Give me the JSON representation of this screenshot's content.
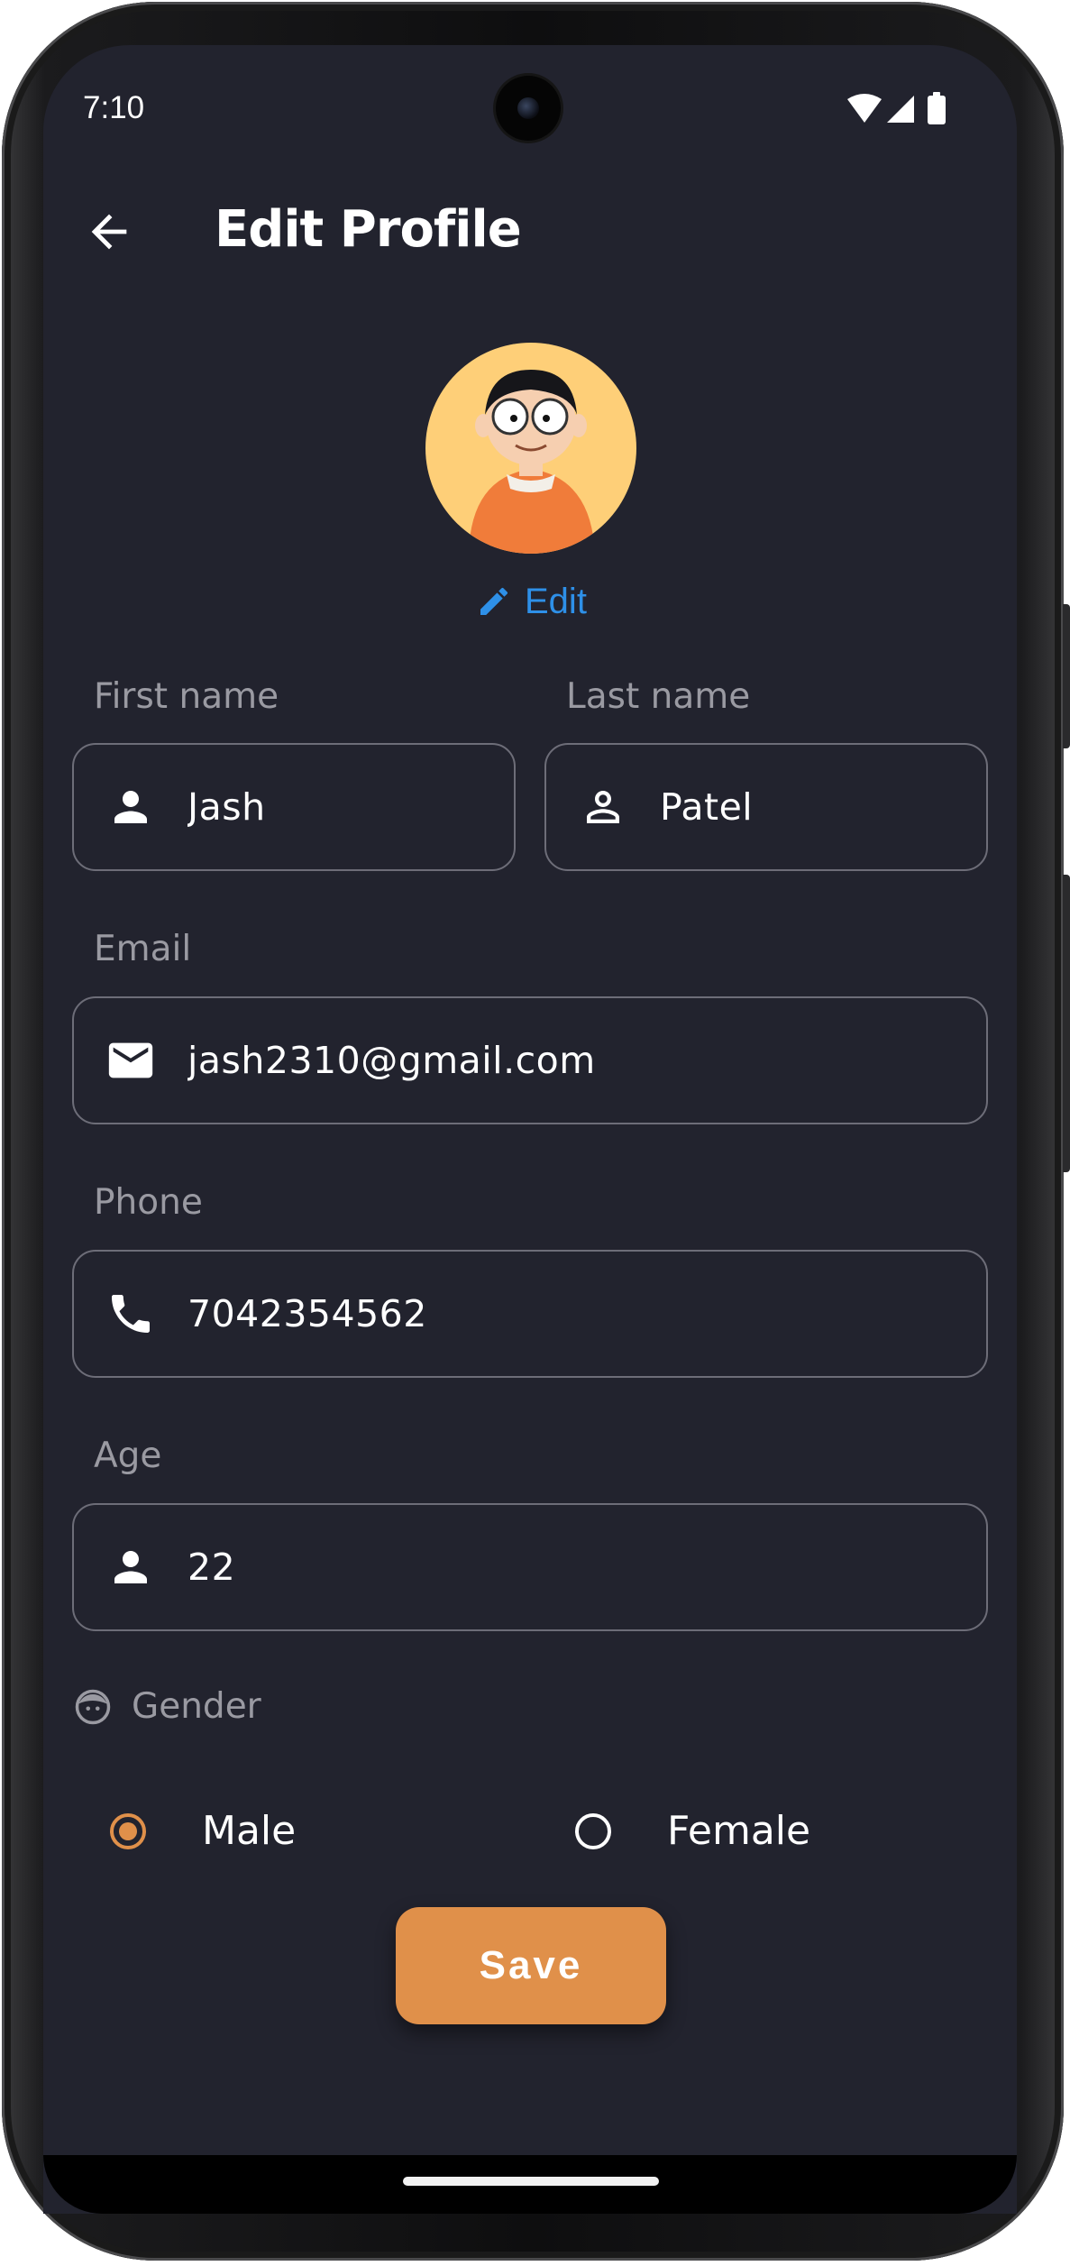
{
  "status_bar": {
    "time": "7:10",
    "icons": [
      "wifi-icon",
      "cell-signal-icon",
      "battery-icon"
    ]
  },
  "header": {
    "title": "Edit Profile",
    "back_icon": "arrow-back-icon"
  },
  "avatar": {
    "edit_label": "Edit",
    "edit_icon": "pencil-icon"
  },
  "form": {
    "first_name": {
      "label": "First name",
      "value": "Jash",
      "icon": "person-filled-icon"
    },
    "last_name": {
      "label": "Last name",
      "value": "Patel",
      "icon": "person-outline-icon"
    },
    "email": {
      "label": "Email",
      "value": "jash2310@gmail.com",
      "icon": "mail-icon"
    },
    "phone": {
      "label": "Phone",
      "value": "7042354562",
      "icon": "phone-icon"
    },
    "age": {
      "label": "Age",
      "value": "22",
      "icon": "person-filled-icon"
    },
    "gender": {
      "label": "Gender",
      "icon": "face-icon",
      "options": [
        {
          "label": "Male",
          "selected": true
        },
        {
          "label": "Female",
          "selected": false
        }
      ]
    }
  },
  "save_label": "Save",
  "colors": {
    "background": "#22232e",
    "accent": "#e0904a",
    "link": "#2e90e8",
    "field_border": "#6d6d78",
    "label": "#9a9aa2"
  }
}
